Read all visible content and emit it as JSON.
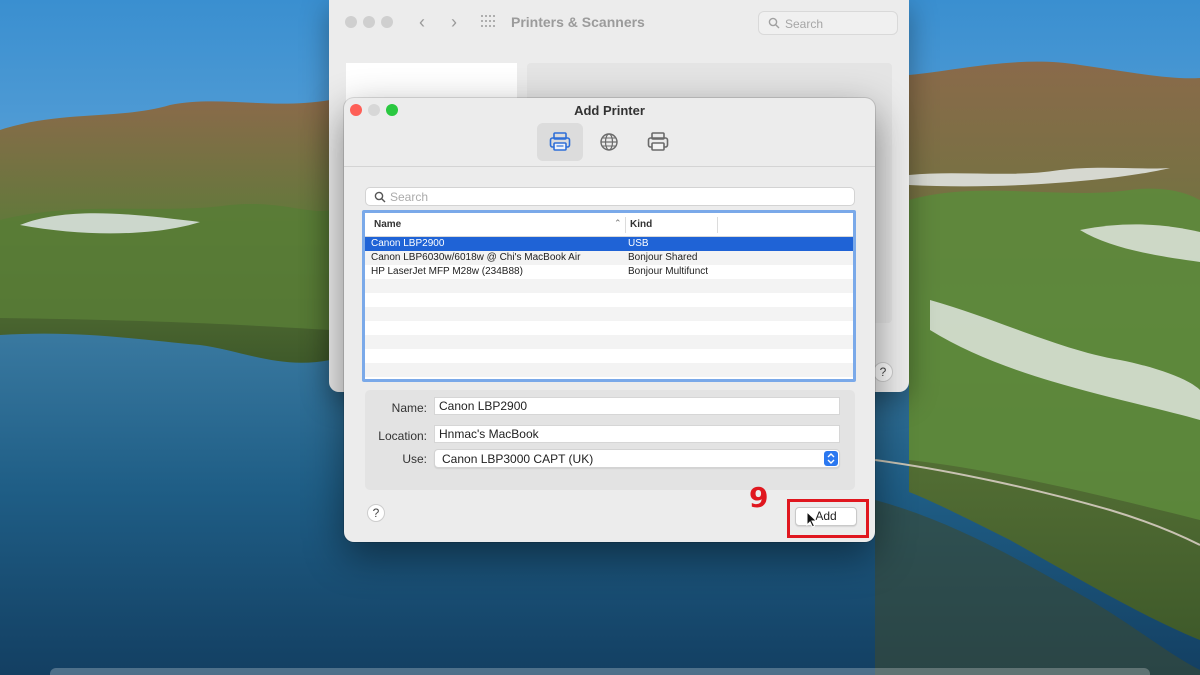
{
  "background_window": {
    "title": "Printers & Scanners",
    "search_placeholder": "Search",
    "help_label": "?"
  },
  "dialog": {
    "title": "Add Printer",
    "toolbar": [
      "default-printers-icon",
      "ip-globe-icon",
      "windows-printer-icon"
    ],
    "search_placeholder": "Search",
    "table": {
      "columns": [
        "Name",
        "Kind"
      ],
      "rows": [
        {
          "name": "Canon LBP2900",
          "kind": "USB",
          "selected": true
        },
        {
          "name": "Canon LBP6030w/6018w @ Chi's MacBook Air",
          "kind": "Bonjour Shared",
          "selected": false
        },
        {
          "name": "HP LaserJet MFP M28w (234B88)",
          "kind": "Bonjour Multifunct",
          "selected": false
        }
      ]
    },
    "form": {
      "name_label": "Name:",
      "name_value": "Canon LBP2900",
      "location_label": "Location:",
      "location_value": "Hnmac's MacBook",
      "use_label": "Use:",
      "use_value": "Canon LBP3000 CAPT (UK)"
    },
    "help_label": "?",
    "add_label": "Add"
  },
  "annotation": {
    "step_number": "9",
    "color": "#e0171f"
  },
  "colors": {
    "selection": "#1f63d6",
    "focus_ring": "#7aa9e9",
    "close": "#fe5f57",
    "zoom": "#2ac840"
  }
}
